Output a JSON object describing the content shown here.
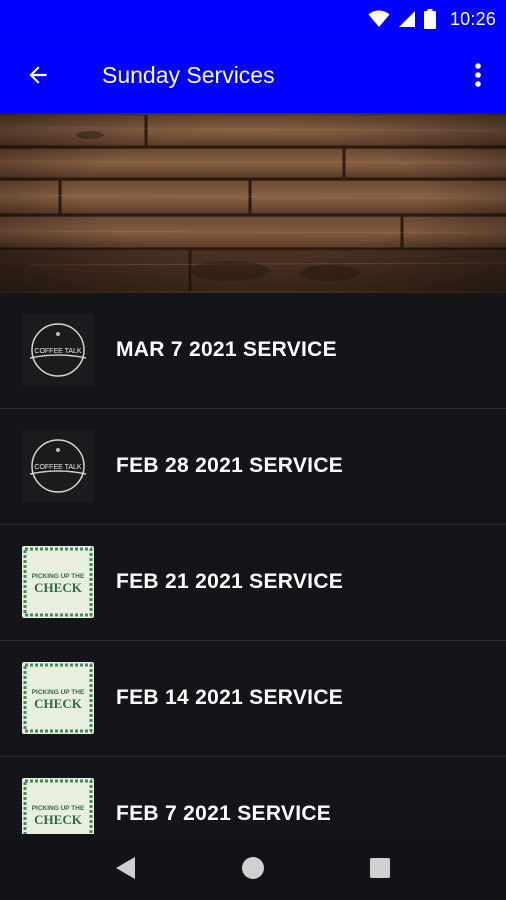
{
  "status_bar": {
    "time": "10:26",
    "icons": [
      "wifi-icon",
      "signal-icon",
      "battery-icon"
    ]
  },
  "app_bar": {
    "title": "Sunday Services",
    "back_icon": "arrow-back-icon",
    "menu_icon": "more-vert-icon",
    "color": "#0000fe"
  },
  "thumb_text": {
    "coffee_talk": "COFFEE TALK",
    "picking_up_line1": "PICKING UP THE",
    "picking_up_line2": "CHECK"
  },
  "services": [
    {
      "label": "MAR 7 2021 SERVICE",
      "thumbnail": "coffee-talk"
    },
    {
      "label": "FEB 28 2021 SERVICE",
      "thumbnail": "coffee-talk"
    },
    {
      "label": "FEB 21 2021 SERVICE",
      "thumbnail": "picking-up-the-check"
    },
    {
      "label": "FEB 14 2021 SERVICE",
      "thumbnail": "picking-up-the-check"
    },
    {
      "label": "FEB 7 2021 SERVICE",
      "thumbnail": "picking-up-the-check"
    }
  ],
  "nav_bar": {
    "icons": [
      "back-triangle-icon",
      "home-circle-icon",
      "recents-square-icon"
    ]
  }
}
